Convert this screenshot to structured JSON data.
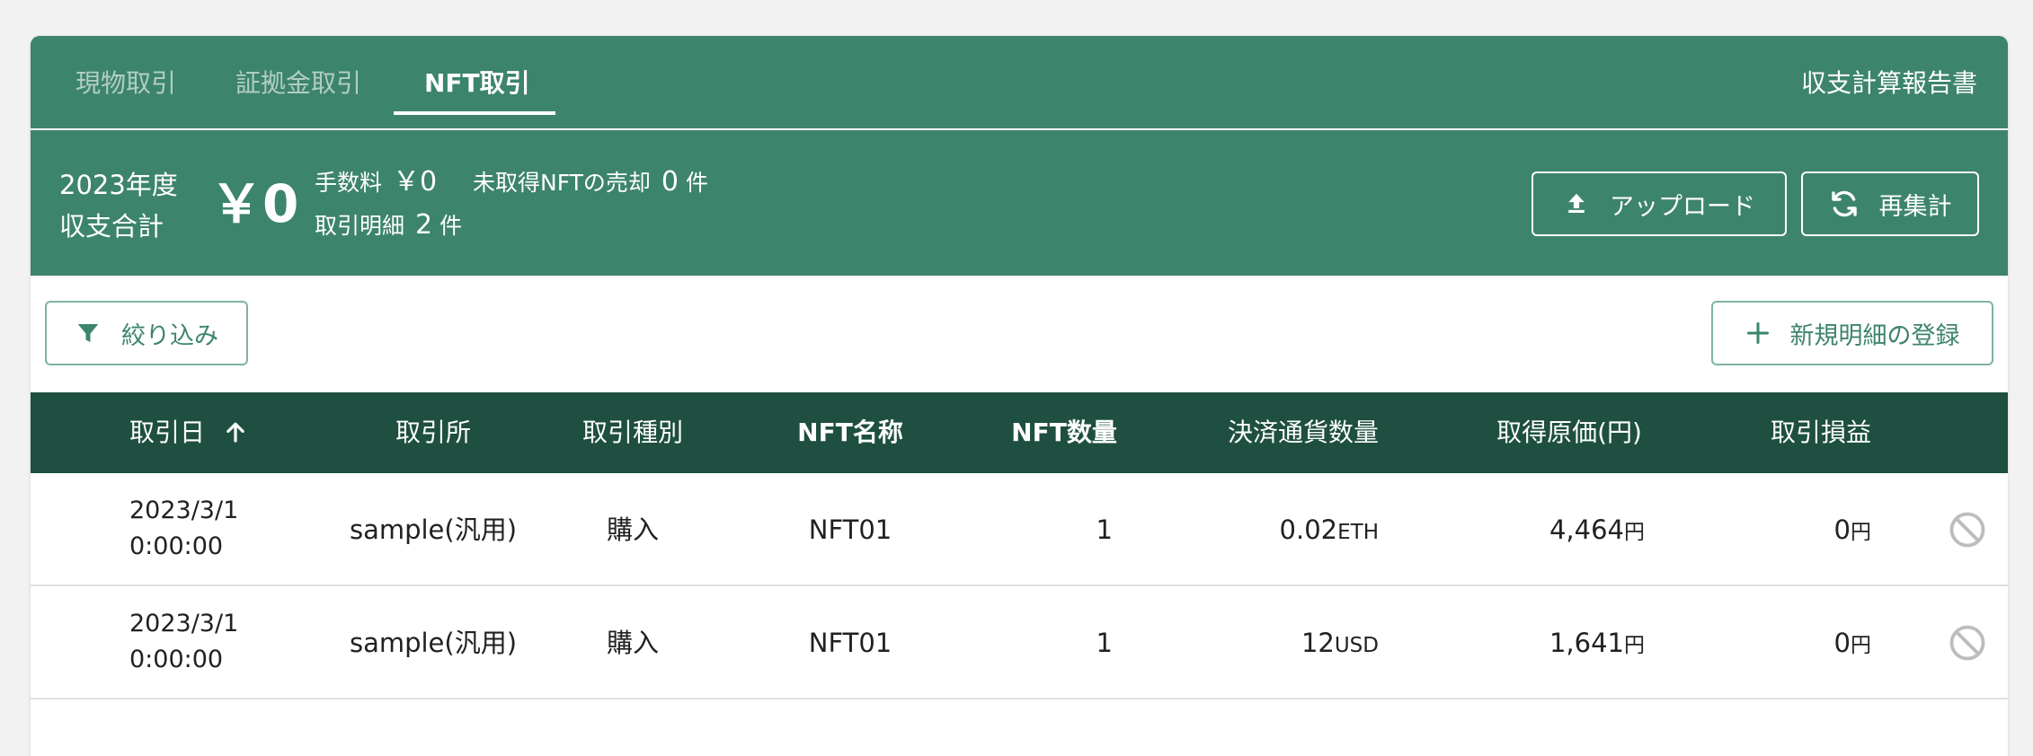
{
  "tabs": [
    {
      "label": "現物取引",
      "active": false
    },
    {
      "label": "証拠金取引",
      "active": false
    },
    {
      "label": "NFT取引",
      "active": true
    }
  ],
  "report_link": "収支計算報告書",
  "summary": {
    "year_line1": "2023年度",
    "year_line2": "収支合計",
    "total": "￥0",
    "fee_label": "手数料",
    "fee_value": "￥0",
    "unacquired_label": "未取得NFTの売却",
    "unacquired_value": "0",
    "unacquired_unit": "件",
    "details_label": "取引明細",
    "details_value": "2",
    "details_unit": "件"
  },
  "buttons": {
    "upload": "アップロード",
    "recalc": "再集計",
    "filter": "絞り込み",
    "new_entry": "新規明細の登録"
  },
  "table": {
    "headers": {
      "date": "取引日",
      "exchange": "取引所",
      "type": "取引種別",
      "nft_name": "NFT名称",
      "nft_qty": "NFT数量",
      "settle_qty": "決済通貨数量",
      "cost": "取得原価(円)",
      "pnl": "取引損益"
    },
    "rows": [
      {
        "date_line1": "2023/3/1",
        "date_line2": "0:00:00",
        "exchange": "sample(汎用)",
        "type": "購入",
        "nft_name": "NFT01",
        "nft_qty": "1",
        "settle_value": "0.02",
        "settle_unit": "ETH",
        "cost_value": "4,464",
        "cost_unit": "円",
        "pnl_value": "0",
        "pnl_unit": "円"
      },
      {
        "date_line1": "2023/3/1",
        "date_line2": "0:00:00",
        "exchange": "sample(汎用)",
        "type": "購入",
        "nft_name": "NFT01",
        "nft_qty": "1",
        "settle_value": "12",
        "settle_unit": "USD",
        "cost_value": "1,641",
        "cost_unit": "円",
        "pnl_value": "0",
        "pnl_unit": "円"
      }
    ]
  },
  "icons": {
    "upload": "upload-icon",
    "recalc": "refresh-icon",
    "filter": "filter-icon",
    "add": "plus-icon",
    "sort": "arrow-up-icon",
    "cancel": "cancel-icon"
  },
  "colors": {
    "header_green": "#3d846d",
    "table_header": "#1e4f40",
    "accent_text": "#3d846d"
  }
}
